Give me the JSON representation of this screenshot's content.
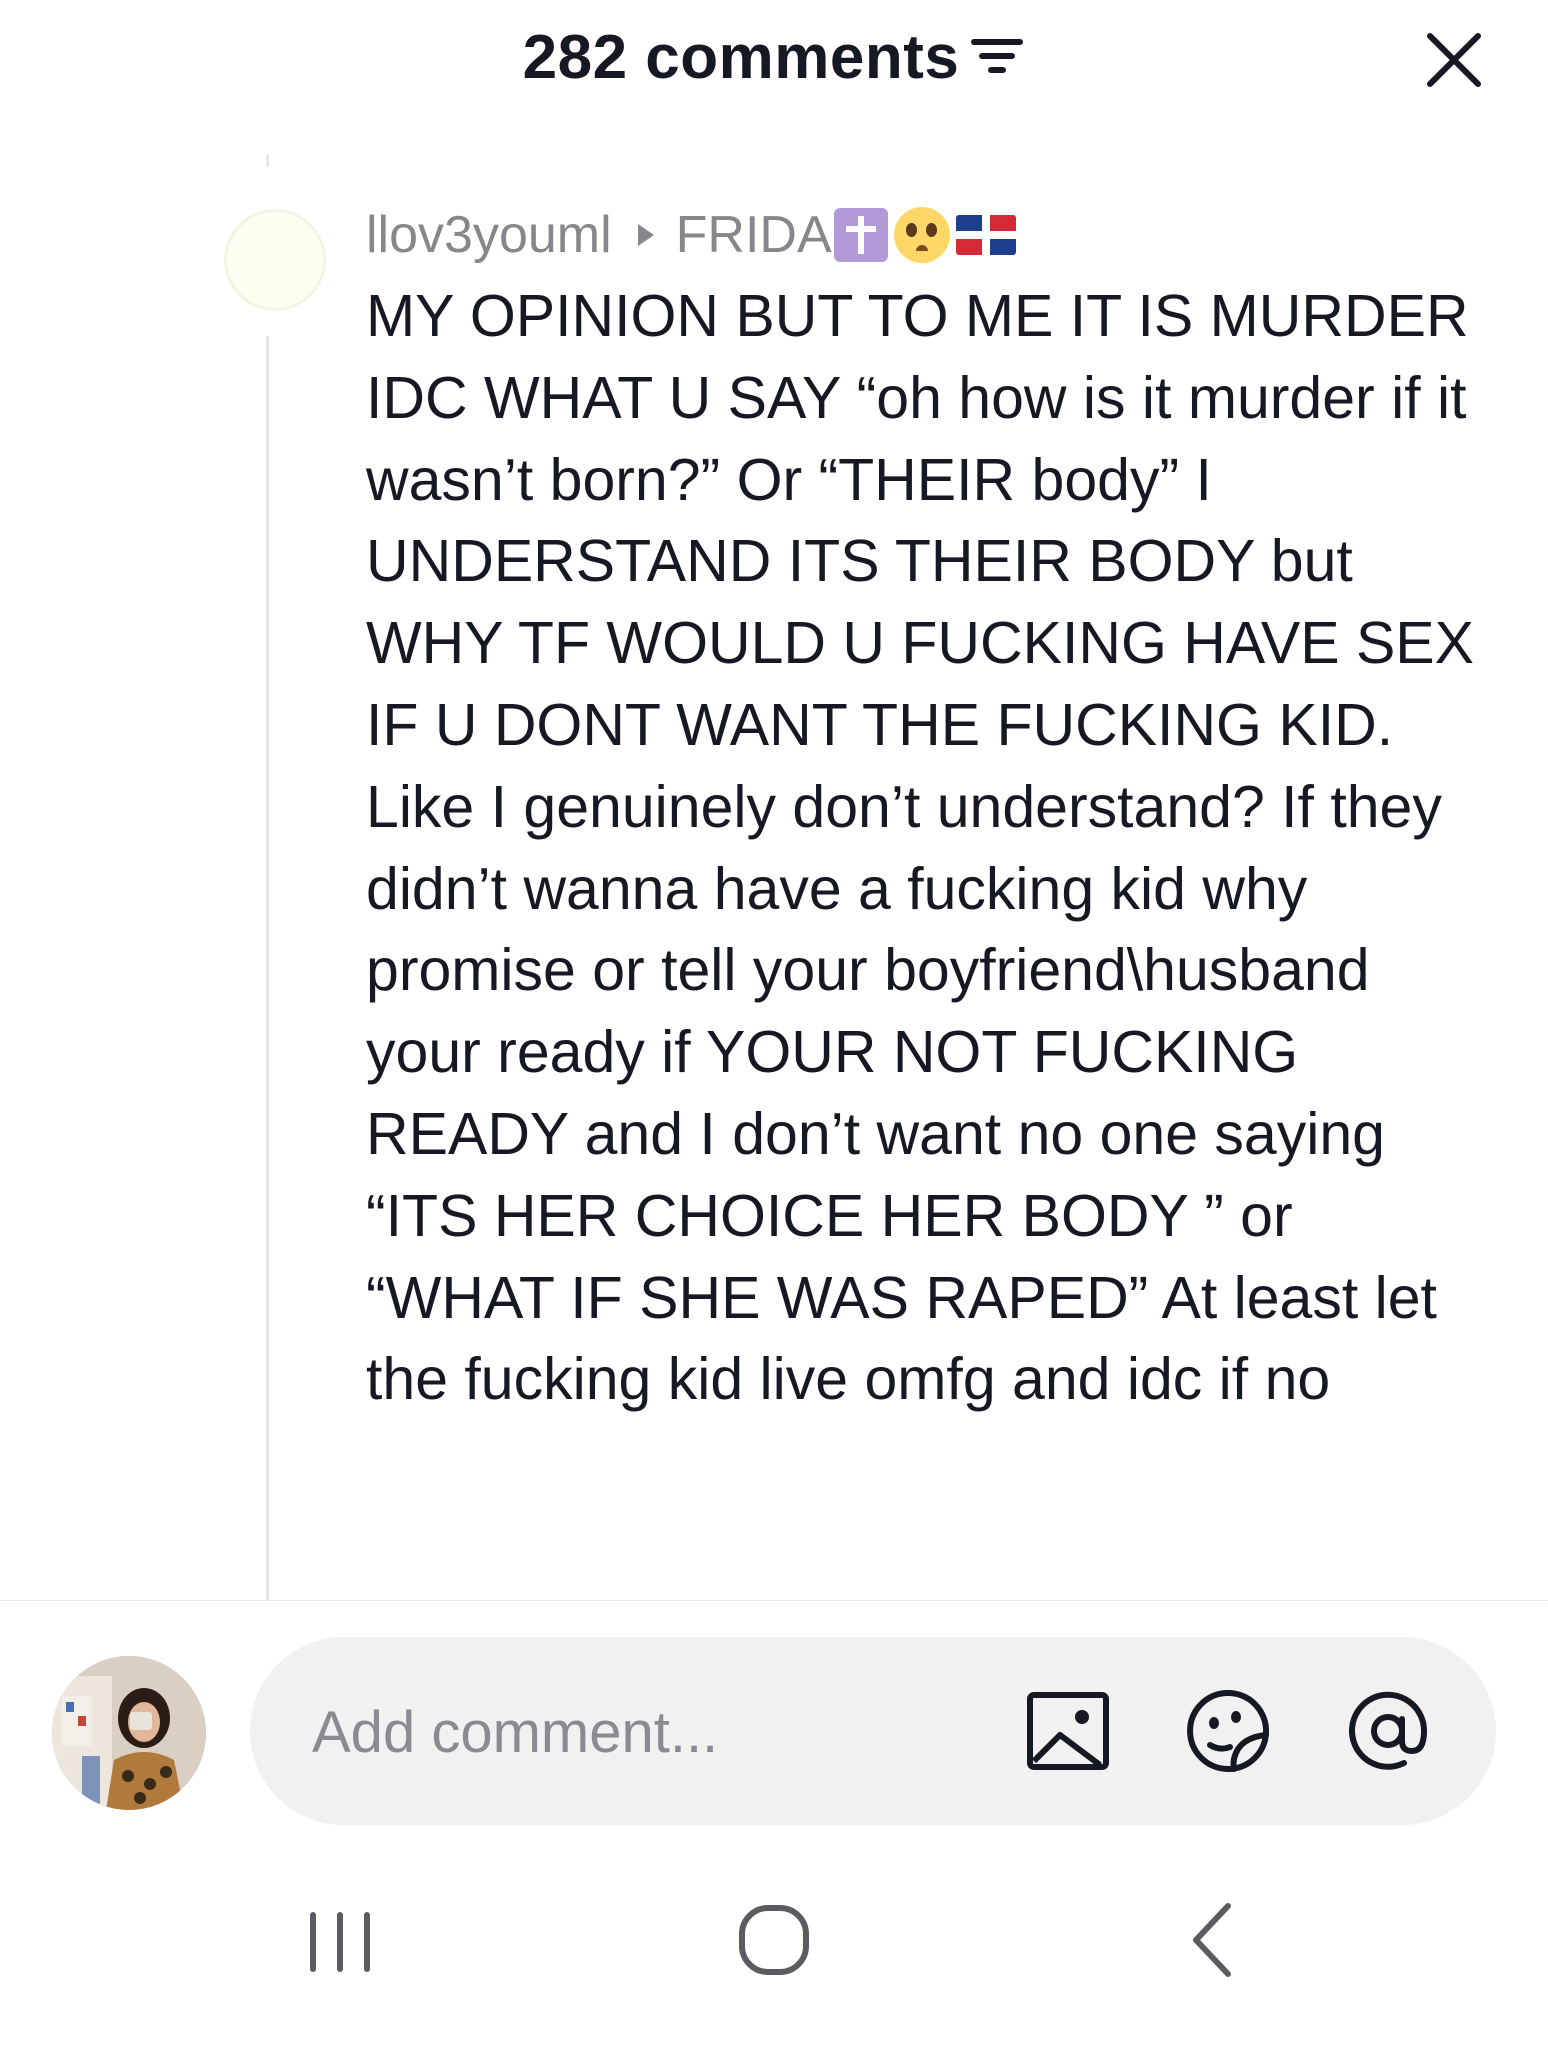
{
  "header": {
    "title": "282 comments",
    "filter_icon": "filter-icon",
    "close_icon": "close-icon"
  },
  "comment": {
    "author": "llov3youml",
    "reply_to": "FRIDA",
    "reply_to_emojis": [
      "latin-cross-emoji",
      "pleading-face-emoji",
      "dominican-republic-flag-emoji"
    ],
    "body": "MY OPINION BUT TO ME IT IS MURDER IDC WHAT U SAY “oh how is it murder if it wasn’t born?” Or “THEIR body” I UNDERSTAND ITS THEIR BODY but WHY TF WOULD U FUCKING HAVE SEX IF U DONT WANT THE FUCKING KID. Like I genuinely don’t understand? If they didn’t wanna have a fucking kid why promise or tell your boyfriend\\husband your ready if YOUR NOT FUCKING READY and I don’t want no one saying “ITS HER CHOICE HER BODY ” or “WHAT IF SHE WAS RAPED” At least let the fucking kid live omfg and idc if no"
  },
  "composer": {
    "placeholder": "Add comment...",
    "icons": [
      "image-icon",
      "emoji-sticker-icon",
      "mention-icon"
    ]
  },
  "nav": {
    "icons": [
      "recent-apps-icon",
      "home-icon",
      "back-icon"
    ]
  },
  "colors": {
    "text_primary": "#161823",
    "text_secondary": "#86878b",
    "input_background": "#f1f1f2",
    "thread_line": "#e6e6e8"
  }
}
